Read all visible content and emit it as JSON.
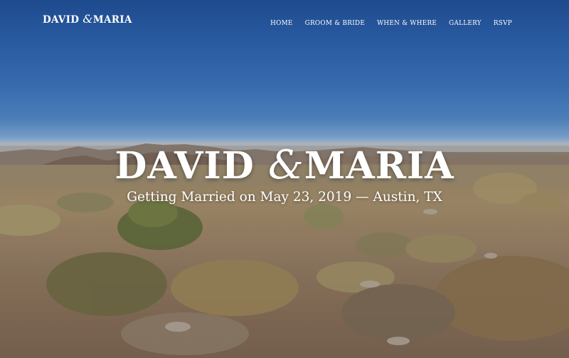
{
  "brand": {
    "name_left": "DAVID",
    "ampersand": "&",
    "name_right": "MARIA"
  },
  "nav": {
    "items": [
      {
        "label": "HOME"
      },
      {
        "label": "GROOM & BRIDE"
      },
      {
        "label": "WHEN & WHERE"
      },
      {
        "label": "GALLERY"
      },
      {
        "label": "RSVP"
      }
    ]
  },
  "hero": {
    "title_left": "DAVID",
    "ampersand": "&",
    "title_right": "MARIA",
    "subtitle": "Getting Married on May 23, 2019 — Austin, TX"
  },
  "colors": {
    "sky_top": "#1f4f98",
    "sky_horizon": "#c1cdd8",
    "ground": "#9c8466",
    "text": "#ffffff"
  }
}
